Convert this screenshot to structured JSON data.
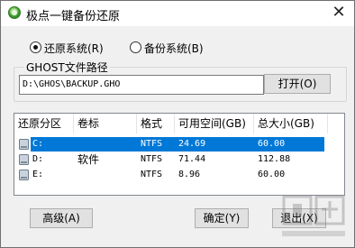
{
  "window": {
    "title": "极点一键备份还原",
    "close_glyph": "✕"
  },
  "mode": {
    "restore_label": "还原系统(R)",
    "backup_label": "备份系统(B)",
    "selected": "restore"
  },
  "ghost": {
    "group_label": "GHOST文件路径",
    "path_value": "D:\\GHOS\\BACKUP.GHO",
    "open_button": "打开(O)"
  },
  "partitions": {
    "columns": [
      "还原分区",
      "卷标",
      "格式",
      "可用空间(GB)",
      "总大小(GB)"
    ],
    "rows": [
      {
        "drive": "C:",
        "label": "",
        "format": "NTFS",
        "free": "24.69",
        "total": "60.00",
        "selected": true
      },
      {
        "drive": "D:",
        "label": "软件",
        "format": "NTFS",
        "free": "71.44",
        "total": "112.88",
        "selected": false
      },
      {
        "drive": "E:",
        "label": "",
        "format": "NTFS",
        "free": "8.96",
        "total": "60.00",
        "selected": false
      }
    ]
  },
  "buttons": {
    "advanced": "高级(A)",
    "confirm": "确定(Y)",
    "exit": "退出(X)"
  },
  "icons": {
    "app": "app-logo-icon",
    "close": "close-icon",
    "disk": "disk-icon"
  }
}
